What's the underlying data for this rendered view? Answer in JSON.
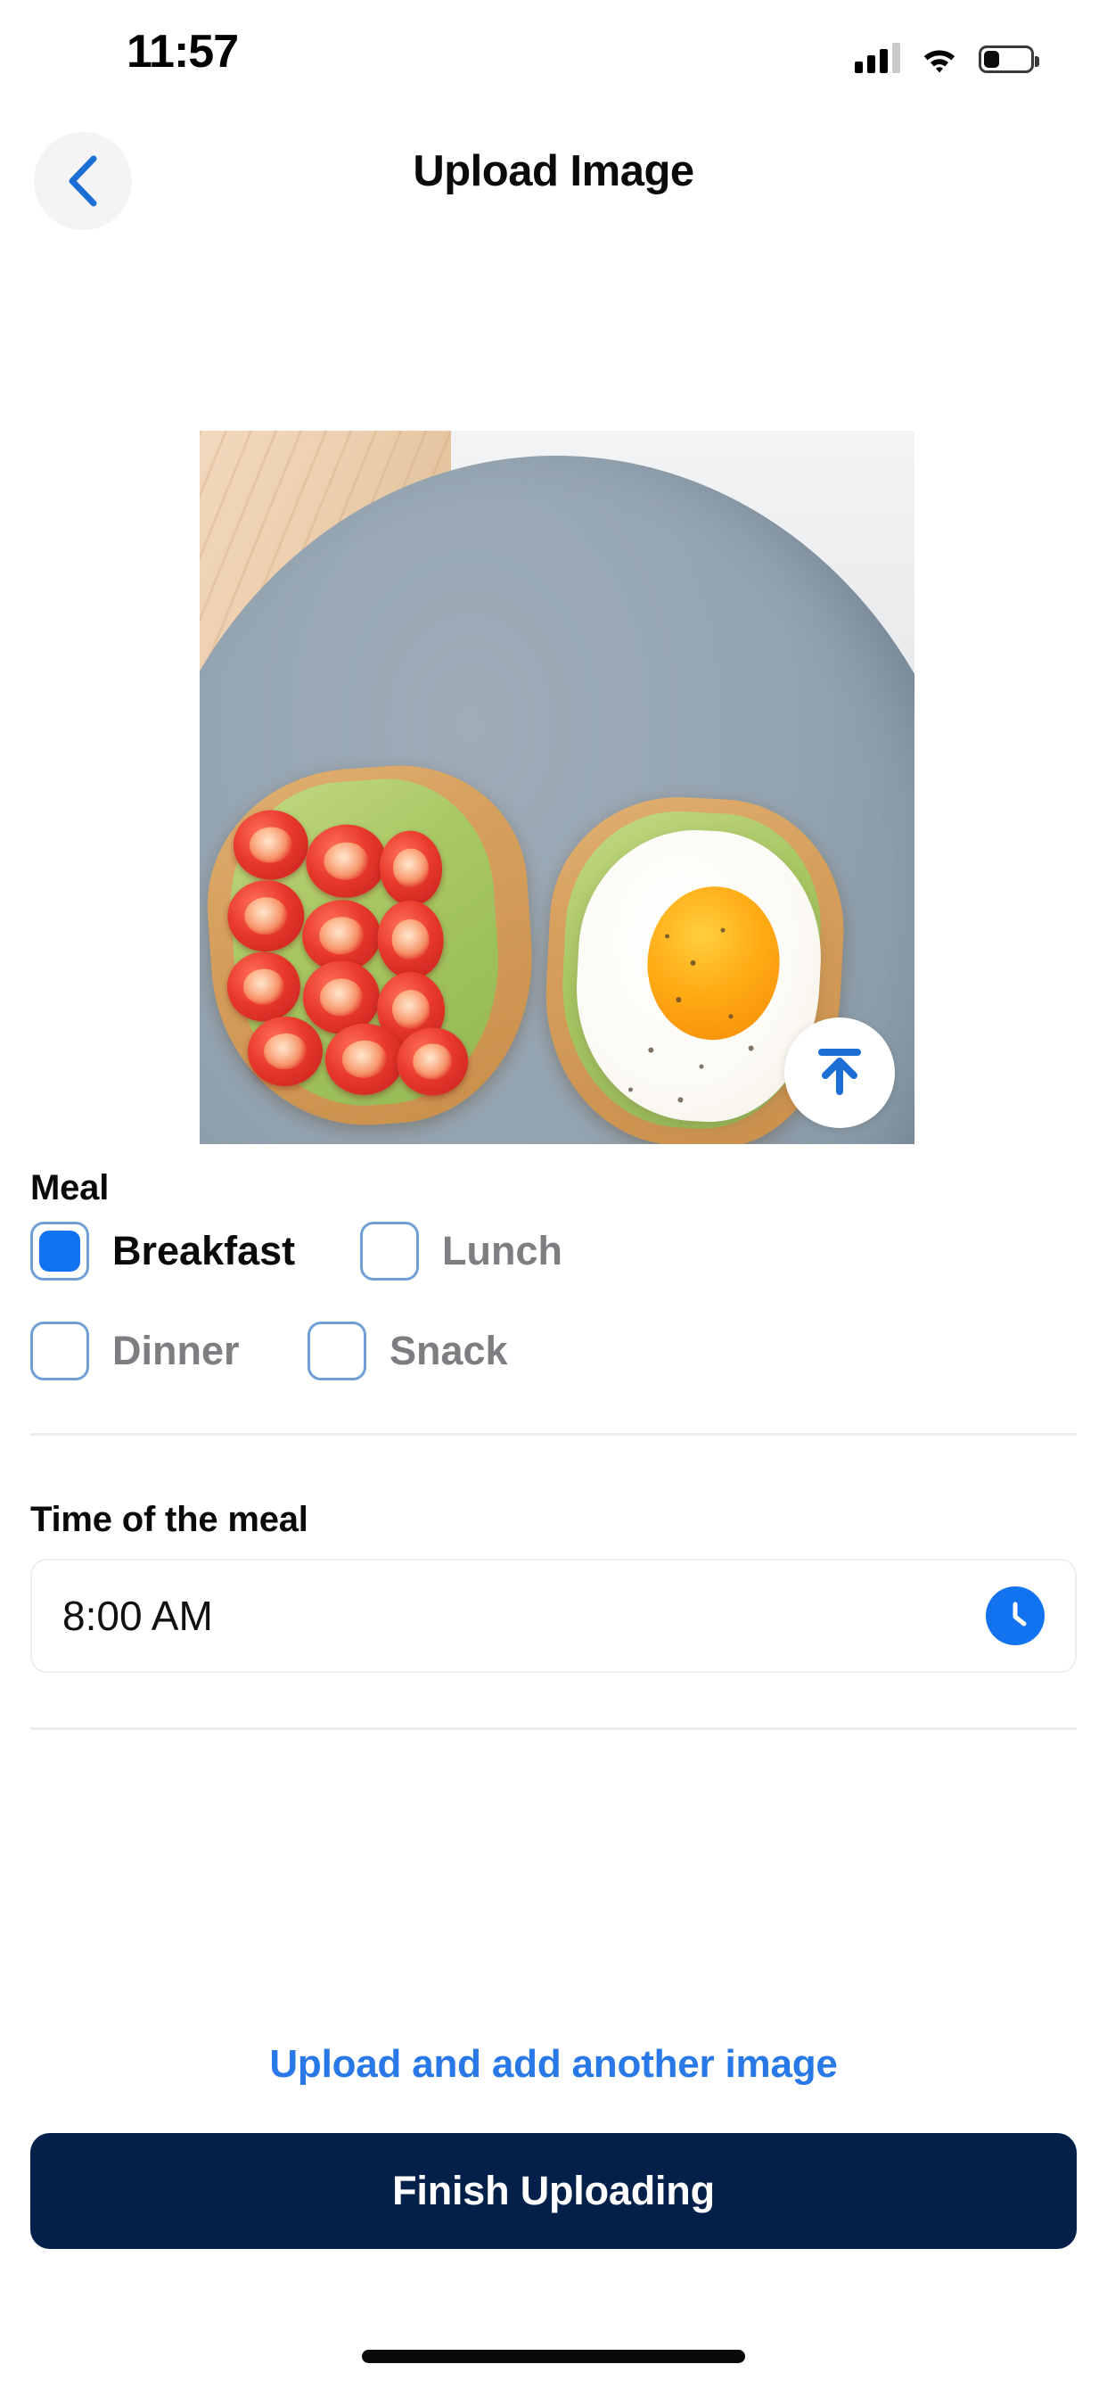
{
  "status_bar": {
    "time": "11:57",
    "signal_icon": "cellular-signal-icon",
    "wifi_icon": "wifi-icon",
    "battery_icon": "battery-icon",
    "battery_level_percent": 30
  },
  "nav": {
    "back_icon": "chevron-left-icon",
    "title": "Upload Image"
  },
  "preview": {
    "alt": "avocado toast with cherry tomatoes and fried egg on a gray plate",
    "upload_icon": "upload-arrow-icon"
  },
  "meal": {
    "label": "Meal",
    "options": [
      {
        "label": "Breakfast",
        "selected": true
      },
      {
        "label": "Lunch",
        "selected": false
      },
      {
        "label": "Dinner",
        "selected": false
      },
      {
        "label": "Snack",
        "selected": false
      }
    ]
  },
  "time": {
    "label": "Time of the meal",
    "value": "8:00 AM",
    "icon": "clock-icon"
  },
  "actions": {
    "secondary_label": "Upload and add another image",
    "primary_label": "Finish Uploading"
  },
  "colors": {
    "accent_blue": "#1273f0",
    "link_blue": "#2878e8",
    "primary_navy": "#02204a",
    "muted_text": "#7e7e82",
    "divider": "#ececee"
  }
}
